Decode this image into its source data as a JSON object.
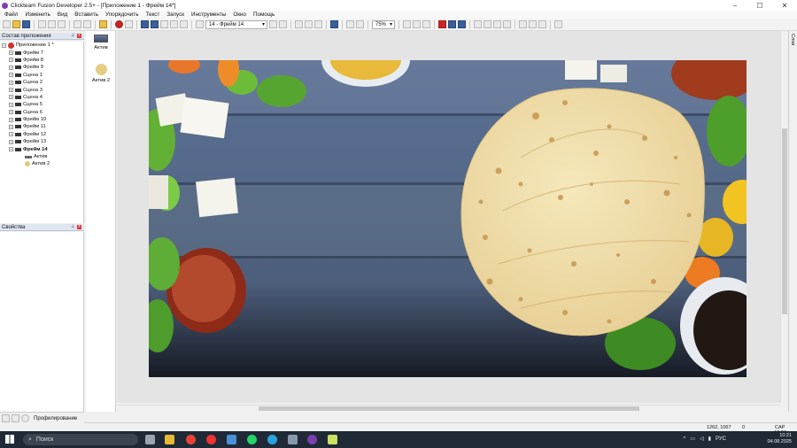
{
  "titlebar": {
    "title": "Clickteam Fusion Developer 2.5+ - [Приложение 1 - Фрейм 14*]"
  },
  "menu": [
    "Файл",
    "Изменить",
    "Вид",
    "Вставить",
    "Упорядочить",
    "Текст",
    "Запуск",
    "Инструменты",
    "Окно",
    "Помощь"
  ],
  "toolbar": {
    "frame_select": "14 - Фрейм 14",
    "zoom": "75%"
  },
  "workspace": {
    "header": "Состав приложения",
    "root": "Приложение 1 *",
    "items": [
      "Фрейм 7",
      "Фрейм 8",
      "Фрейм 9",
      "Сцена 1",
      "Сцена 2",
      "Сцена 3",
      "Сцена 4",
      "Сцена 5",
      "Сцена 6",
      "Фрейм 10",
      "Фрейм 11",
      "Фрейм 12",
      "Фрейм 13",
      "Фрейм 14"
    ],
    "children": [
      "Актив",
      "Актив 2"
    ]
  },
  "properties": {
    "header": "Свойства"
  },
  "object_strip": {
    "items": [
      "Актив",
      "Актив 2"
    ]
  },
  "side_tab": "Слои",
  "profiler": "Профилирование",
  "status": {
    "coords": "1262, 1067",
    "count": "0",
    "caps": "CAP NUM"
  },
  "taskbar": {
    "search": "Поиск",
    "lang": "РУС",
    "time": "10:21",
    "date": "04.08.2025"
  },
  "colors": {
    "board": "#5d7292",
    "tortilla": "#f1e0aa",
    "frame_bg": "#e4e4e4"
  }
}
